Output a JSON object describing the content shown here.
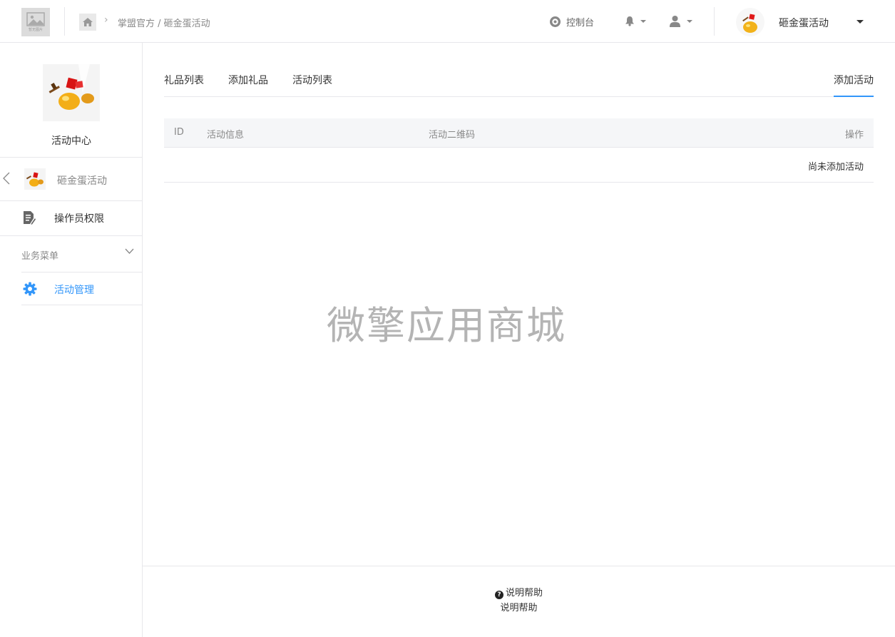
{
  "header": {
    "logo_caption": "暂无图片",
    "breadcrumb": {
      "parent": "掌盟官方",
      "separator": " / ",
      "current": "砸金蛋活动"
    },
    "console_label": "控制台",
    "account_name": "砸金蛋活动"
  },
  "sidebar": {
    "app_title": "活动中心",
    "back_item_label": "砸金蛋活动",
    "permission_label": "操作员权限",
    "menu_group_label": "业务菜单",
    "menu_items": [
      {
        "label": "活动管理"
      }
    ]
  },
  "tabs": [
    {
      "label": "礼品列表"
    },
    {
      "label": "添加礼品"
    },
    {
      "label": "活动列表"
    },
    {
      "label": "添加活动"
    }
  ],
  "table": {
    "columns": [
      "ID",
      "活动信息",
      "活动二维码",
      "操作"
    ],
    "empty_text": "尚未添加活动"
  },
  "watermark": "微擎应用商城",
  "footer": {
    "help_link": "说明帮助",
    "help_text": "说明帮助"
  },
  "colors": {
    "accent": "#3296fa",
    "border": "#e7e7eb",
    "table_header_bg": "#f5f6f8"
  }
}
